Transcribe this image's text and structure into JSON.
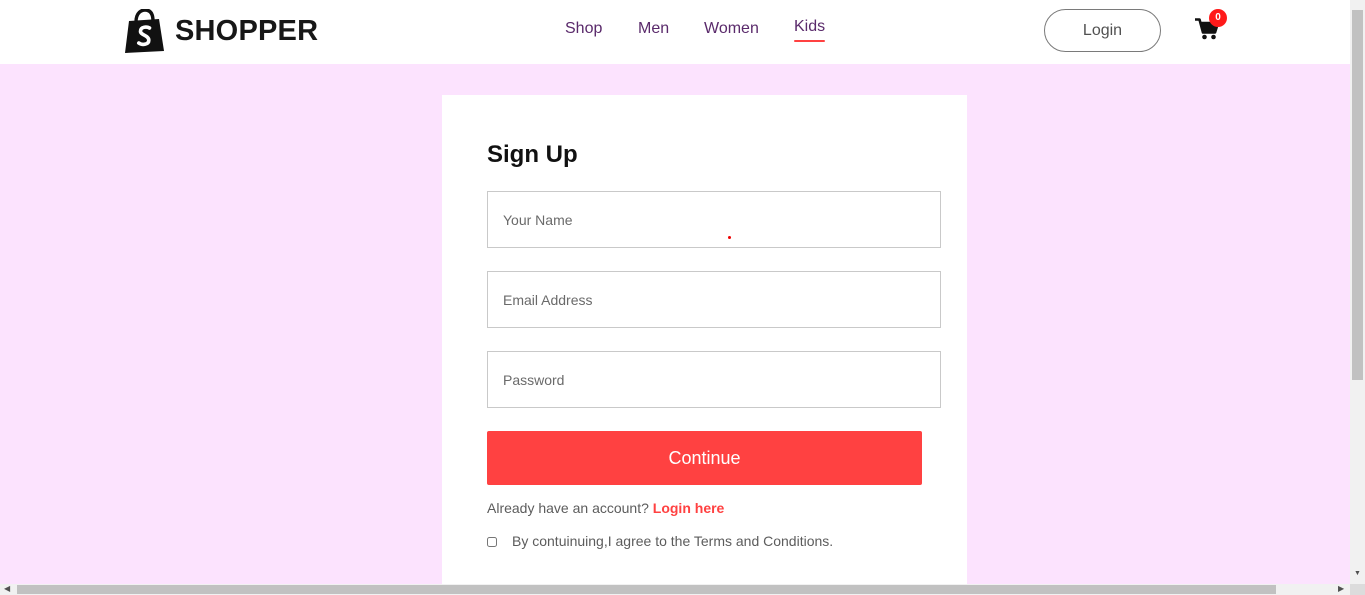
{
  "brand": {
    "name": "SHOPPER",
    "logo_icon": "shopping-bag-icon"
  },
  "nav": {
    "items": [
      {
        "label": "Shop",
        "active": false
      },
      {
        "label": "Men",
        "active": false
      },
      {
        "label": "Women",
        "active": false
      },
      {
        "label": "Kids",
        "active": true
      }
    ],
    "login_label": "Login",
    "cart_icon": "cart-icon",
    "cart_count": "0"
  },
  "signup": {
    "title": "Sign Up",
    "name_placeholder": "Your Name",
    "email_placeholder": "Email Address",
    "password_placeholder": "Password",
    "continue_label": "Continue",
    "login_prompt": "Already have an account?",
    "login_link": "Login here",
    "terms_text": "By contuinuing,I agree to the Terms and Conditions.",
    "terms_checked": false
  },
  "colors": {
    "accent": "#ff4141",
    "page_background": "#fce3fe",
    "nav_text": "#5a2a6b"
  }
}
